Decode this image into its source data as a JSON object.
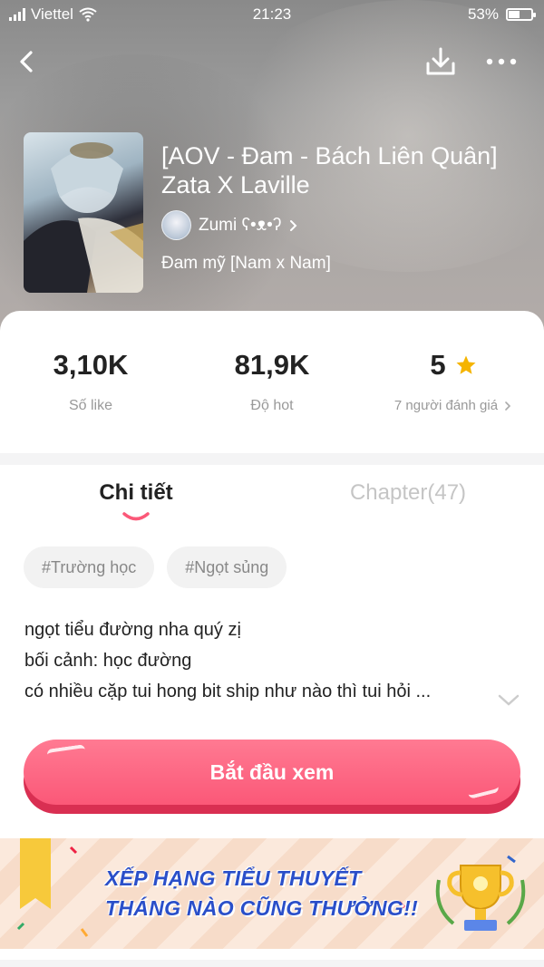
{
  "status_bar": {
    "carrier": "Viettel",
    "time": "21:23",
    "battery": "53%"
  },
  "book": {
    "title": "[AOV - Đam - Bách Liên Quân] Zata X Laville",
    "author": "Zumi ʕ•ᴥ•ʔ",
    "genre": "Đam mỹ [Nam x Nam]"
  },
  "stats": [
    {
      "value": "3,10K",
      "label": "Số like"
    },
    {
      "value": "81,9K",
      "label": "Độ hot"
    },
    {
      "value": "5",
      "label": "7 người đánh giá"
    }
  ],
  "tabs": [
    {
      "label": "Chi tiết"
    },
    {
      "label": "Chapter(47)"
    }
  ],
  "tags": [
    "#Trường học",
    "#Ngọt sủng"
  ],
  "description": [
    "ngọt tiểu đường nha quý zị",
    "bối cảnh: học đường",
    "có nhiều cặp tui hong bit ship như nào thì tui hỏi ..."
  ],
  "start_button": "Bắt đầu xem",
  "banner": {
    "line1": "XẾP HẠNG TIỂU THUYẾT",
    "line2": "THÁNG NÀO CŨNG THƯỞNG!!"
  },
  "colors": {
    "accent": "#fb5878",
    "star": "#f5b400",
    "banner_text": "#2a4fc9"
  }
}
